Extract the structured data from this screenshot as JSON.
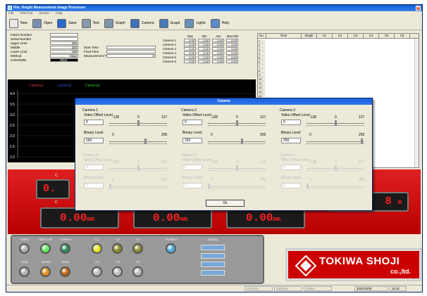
{
  "window": {
    "title": "File: Height Measurement Image Processor",
    "close": "✕"
  },
  "menu": [
    "File",
    "Print Out",
    "Screen",
    "Help"
  ],
  "toolbar": [
    {
      "label": "New",
      "icon": "new-icon",
      "color": "#e8e8e8"
    },
    {
      "label": "Open",
      "icon": "open-icon",
      "color": "#7a8fb0"
    },
    {
      "label": "Save",
      "icon": "save-icon",
      "color": "#2b6ac8"
    },
    {
      "label": "Text",
      "icon": "text-icon",
      "color": "#8a99aa"
    },
    {
      "label": "Graph",
      "icon": "graph-icon",
      "color": "#7d96a8"
    },
    {
      "label": "Camera",
      "icon": "camera-icon",
      "color": "#4070b8"
    },
    {
      "label": "Graph",
      "icon": "graph-icon",
      "color": "#4a7ab8"
    },
    {
      "label": "Lights",
      "icon": "lights-icon",
      "color": "#6a90b8"
    },
    {
      "label": "Help",
      "icon": "help-icon",
      "color": "#5a8ac8"
    }
  ],
  "fields": [
    {
      "label": "Fabric Number",
      "value": "",
      "label2": "",
      "value2": ""
    },
    {
      "label": "Serial Number",
      "value": "",
      "label2": "",
      "value2": ""
    },
    {
      "label": "Upper Limit",
      "value": "300",
      "label2": "",
      "value2": ""
    },
    {
      "label": "Middle",
      "value": "250",
      "label2": "Start Time",
      "value2": ""
    },
    {
      "label": "Lower Limit",
      "value": "150",
      "label2": "Final Time",
      "value2": ""
    },
    {
      "label": "Method",
      "value": "Edge",
      "label2": "Measurement Times",
      "value2": "0"
    },
    {
      "label": "Color/W/BI",
      "value": "Black",
      "label2": "",
      "value2": ""
    }
  ],
  "camera_table": {
    "headers": [
      "Max",
      "Min",
      "Ave",
      "Max-Min"
    ],
    "rows": [
      {
        "label": "Camera 1",
        "values": [
          "0.00",
          "0.00",
          "0.00",
          "0.00"
        ]
      },
      {
        "label": "Camera 2",
        "values": [
          "0.00",
          "0.00",
          "0.00",
          "0.00"
        ]
      },
      {
        "label": "Camera 3",
        "values": [
          "0.00",
          "0.00",
          "0.00",
          "0.00"
        ]
      },
      {
        "label": "Camera 4",
        "values": [
          "0.00",
          "0.00",
          "0.00",
          "0.00"
        ]
      },
      {
        "label": "Camera 5",
        "values": [
          "0.00",
          "0.00",
          "0.00",
          "0.00"
        ]
      },
      {
        "label": "Camera 6",
        "values": [
          "0.00",
          "0.00",
          "0.00",
          "0.00"
        ]
      }
    ]
  },
  "data_table": {
    "headers": [
      "No.",
      "Time",
      "length",
      "C1",
      "C2",
      "C3",
      "C4",
      "C5",
      "C6"
    ],
    "row_numbers": [
      "1",
      "2",
      "3",
      "4",
      "5",
      "6",
      "7",
      "8",
      "9",
      "10",
      "11",
      "12",
      "13",
      "14"
    ]
  },
  "scope": {
    "legend": [
      {
        "label": "Camera1",
        "color": "#e03030"
      },
      {
        "label": "Camera2",
        "color": "#3050e0"
      },
      {
        "label": "Camera3",
        "color": "#30c030"
      }
    ],
    "yticks": [
      "4.0",
      "3.5",
      "3.0",
      "2.5",
      "2.0",
      "1.5",
      "1.0"
    ]
  },
  "displays": {
    "top_left": "0.",
    "c1": "0.00",
    "c2": "0.00",
    "c3": "0.00",
    "unit": "mm",
    "right_value": "8",
    "right_unit": "m",
    "labels": [
      "C",
      "C",
      "th"
    ]
  },
  "lamps": {
    "top_labels": [
      "Fabric",
      "Start Use",
      "Camera",
      "C1",
      "C2",
      "C3",
      "Position"
    ],
    "bottom_labels": [
      "Stop",
      "Speed",
      "Base",
      "C4",
      "C5",
      "C6"
    ],
    "display_label": "Display"
  },
  "logo": {
    "name": "TOKIWA SHOJI",
    "suffix": "co.,ltd."
  },
  "status": {
    "date": "2004/03/30",
    "time": "15:16",
    "cells": [
      "Ethernet",
      "Windows",
      "250ms"
    ]
  },
  "dialog": {
    "title": "Camera",
    "ok_label": "Ok",
    "cameras": [
      {
        "name": "Camera 1",
        "offset_label": "Video Offset Level",
        "offset_value": "0",
        "offset_min": "-128",
        "offset_mid": "0",
        "offset_max": "127",
        "offset_level": 0.5,
        "binary_label": "Binary Level",
        "binary_value": "160",
        "binary_min": "0",
        "binary_max": "255",
        "binary_level": 0.63
      },
      {
        "name": "Camera 2",
        "offset_label": "Video Offset Level",
        "offset_value": "0",
        "offset_min": "-128",
        "offset_mid": "0",
        "offset_max": "127",
        "offset_level": 0.5,
        "binary_label": "Binary Level",
        "binary_value": "150",
        "binary_min": "0",
        "binary_max": "255",
        "binary_level": 0.59
      },
      {
        "name": "Camera 3",
        "offset_label": "Video Offset Level",
        "offset_value": "0",
        "offset_min": "-128",
        "offset_mid": "0",
        "offset_max": "127",
        "offset_level": 0.5,
        "binary_label": "Binary Level",
        "binary_value": "250",
        "binary_min": "0",
        "binary_max": "255",
        "binary_level": 0.98
      },
      {
        "name": "Camera 4",
        "offset_label": "Video Offset Level",
        "offset_value": "0",
        "offset_min": "-128",
        "offset_mid": "0",
        "offset_max": "127",
        "offset_level": 0.5,
        "binary_label": "Binary Level",
        "binary_value": "0",
        "binary_min": "0",
        "binary_max": "255",
        "binary_level": 0.0
      },
      {
        "name": "Camera 5",
        "offset_label": "Video Offset Level",
        "offset_value": "0",
        "offset_min": "-128",
        "offset_mid": "0",
        "offset_max": "127",
        "offset_level": 0.5,
        "binary_label": "Binary Level",
        "binary_value": "0",
        "binary_min": "0",
        "binary_max": "255",
        "binary_level": 0.0
      },
      {
        "name": "Camera 6",
        "offset_label": "Video Offset Level",
        "offset_value": "0",
        "offset_min": "-128",
        "offset_mid": "0",
        "offset_max": "127",
        "offset_level": 0.5,
        "binary_label": "Binary Level",
        "binary_value": "0",
        "binary_min": "0",
        "binary_max": "255",
        "binary_level": 0.0
      }
    ]
  }
}
